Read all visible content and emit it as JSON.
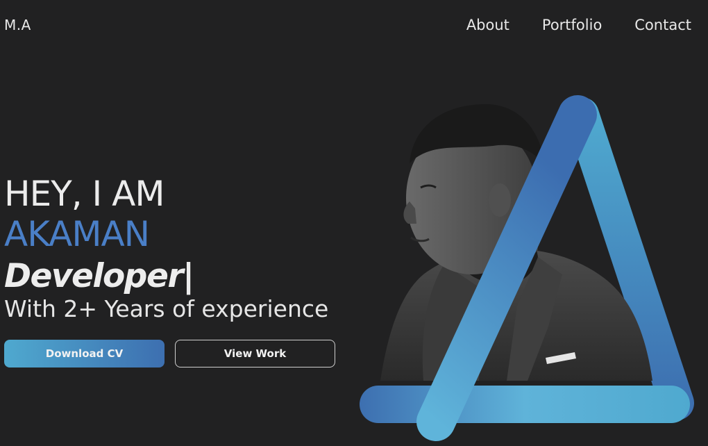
{
  "header": {
    "logo": "M.A",
    "nav": [
      {
        "label": "About"
      },
      {
        "label": "Portfolio"
      },
      {
        "label": "Contact"
      }
    ]
  },
  "hero": {
    "greeting": "HEY, I AM",
    "name": "AKAMAN",
    "role": "Developer|",
    "subtitle": "With 2+ Years of experience",
    "primary_button": "Download CV",
    "secondary_button": "View Work"
  },
  "colors": {
    "background": "#212122",
    "accent_blue": "#4a7fc7",
    "gradient_light": "#4fa9cf",
    "gradient_dark": "#3d6fb0"
  },
  "icons": {
    "hero_shape": "triangle-shape",
    "portrait": "profile-portrait"
  }
}
